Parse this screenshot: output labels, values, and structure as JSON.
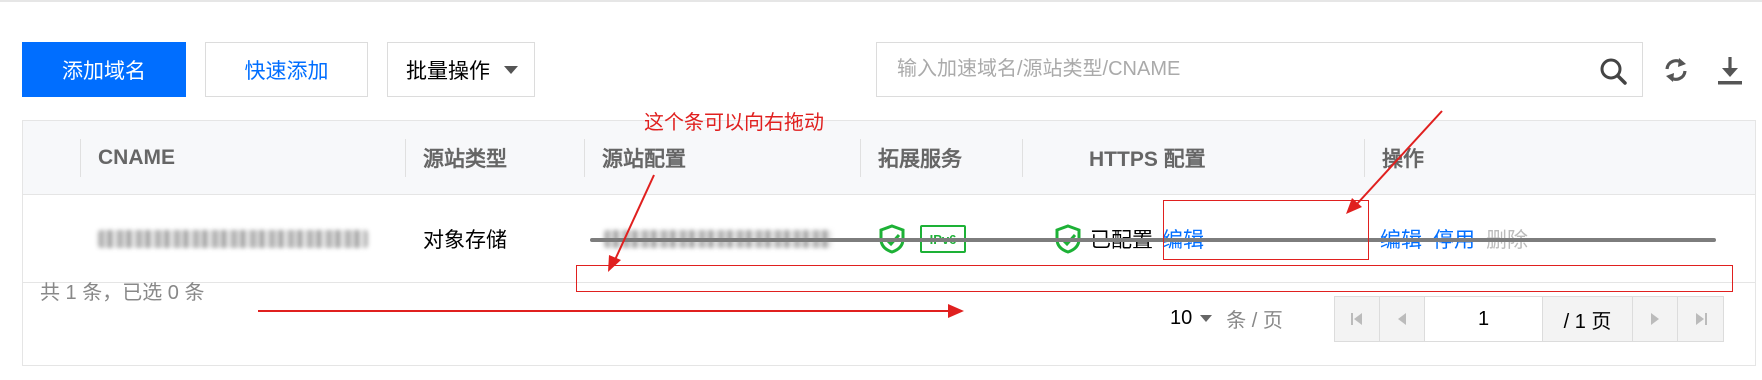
{
  "toolbar": {
    "add_domain_label": "添加域名",
    "quick_add_label": "快速添加",
    "batch_label": "批量操作",
    "search_placeholder": "输入加速域名/源站类型/CNAME"
  },
  "table": {
    "columns": [
      "CNAME",
      "源站类型",
      "源站配置",
      "拓展服务",
      "HTTPS 配置",
      "操作"
    ],
    "rows": [
      {
        "origin_type": "对象存储",
        "ipv6_badge": "IPv6",
        "https_status": "已配置",
        "https_edit": "编辑",
        "actions": [
          "编辑",
          "停用",
          "删除"
        ]
      }
    ]
  },
  "footer": {
    "total": "共 1 条，已选 0 条",
    "page_size": "10",
    "per_page": "条 / 页",
    "current_page": "1",
    "total_pages": "/ 1 页"
  },
  "annotation": {
    "text": "这个条可以向右拖动",
    "color": "#e0201f"
  },
  "colors": {
    "accent": "#006eff",
    "success": "#1db136",
    "annotation": "#e0201f"
  },
  "icons": [
    "search-icon",
    "refresh-icon",
    "download-icon",
    "shield-check-icon",
    "first-page-icon",
    "prev-page-icon",
    "next-page-icon",
    "last-page-icon"
  ]
}
